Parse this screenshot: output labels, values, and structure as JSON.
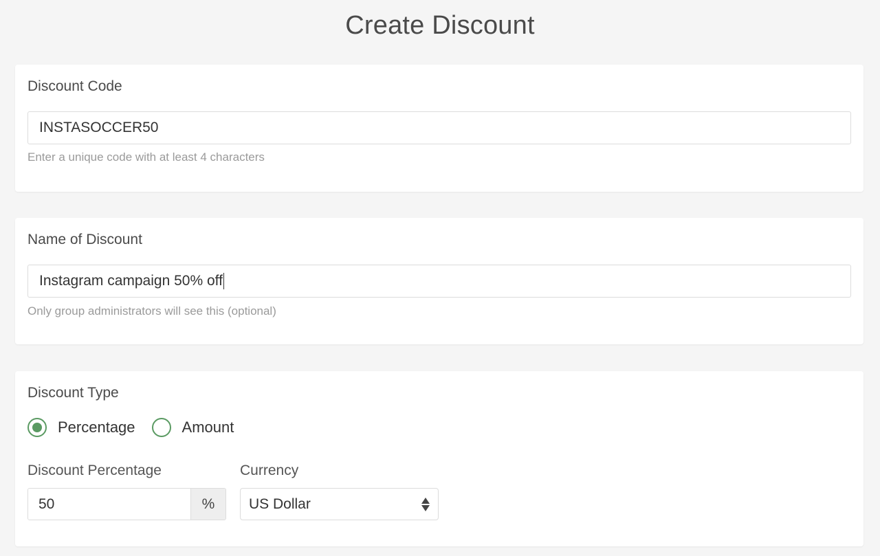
{
  "page": {
    "title": "Create Discount"
  },
  "discount_code": {
    "label": "Discount Code",
    "value": "INSTASOCCER50",
    "help": "Enter a unique code with at least 4 characters"
  },
  "discount_name": {
    "label": "Name of Discount",
    "value": "Instagram campaign 50% off",
    "help": "Only group administrators will see this (optional)"
  },
  "discount_type": {
    "label": "Discount Type",
    "options": [
      {
        "label": "Percentage",
        "selected": true
      },
      {
        "label": "Amount",
        "selected": false
      }
    ],
    "percentage_label": "Discount Percentage",
    "percentage_value": "50",
    "percentage_suffix": "%",
    "currency_label": "Currency",
    "currency_value": "US Dollar"
  },
  "colors": {
    "accent": "#5a9a62",
    "background": "#f5f5f5",
    "card": "#ffffff"
  }
}
